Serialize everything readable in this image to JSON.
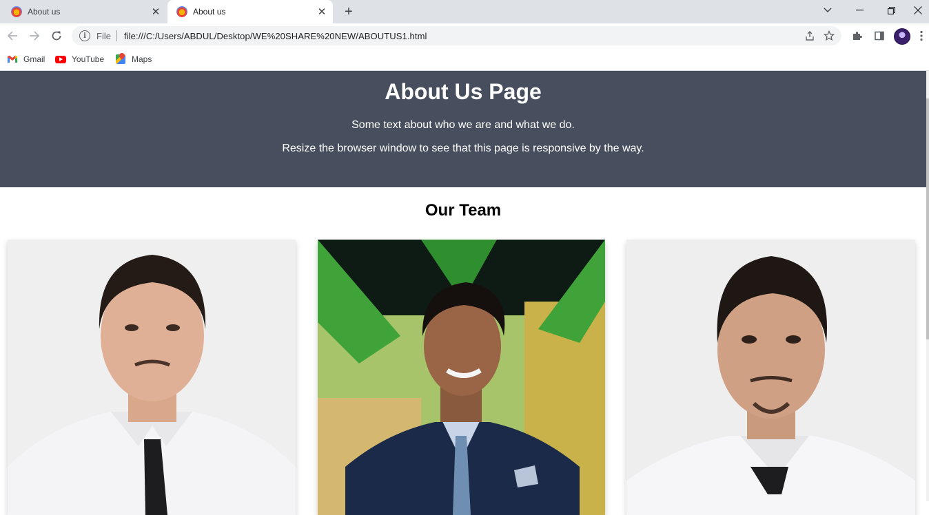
{
  "browser": {
    "tabs": [
      {
        "title": "About us",
        "active": false
      },
      {
        "title": "About us",
        "active": true
      }
    ],
    "address": {
      "scheme_label": "File",
      "url": "file:///C:/Users/ABDUL/Desktop/WE%20SHARE%20NEW/ABOUTUS1.html"
    },
    "bookmarks": [
      {
        "label": "Gmail",
        "icon": "gmail-icon"
      },
      {
        "label": "YouTube",
        "icon": "youtube-icon"
      },
      {
        "label": "Maps",
        "icon": "maps-icon"
      }
    ]
  },
  "hero": {
    "title": "About Us Page",
    "line1": "Some text about who we are and what we do.",
    "line2": "Resize the browser window to see that this page is responsive by the way."
  },
  "team": {
    "heading": "Our Team",
    "members": [
      {
        "photo": "team-member-photo-1"
      },
      {
        "photo": "team-member-photo-2"
      },
      {
        "photo": "team-member-photo-3"
      }
    ]
  },
  "colors": {
    "hero_bg": "#474e5d",
    "tabstrip_bg": "#dee1e6",
    "omnibox_bg": "#f1f3f4"
  }
}
